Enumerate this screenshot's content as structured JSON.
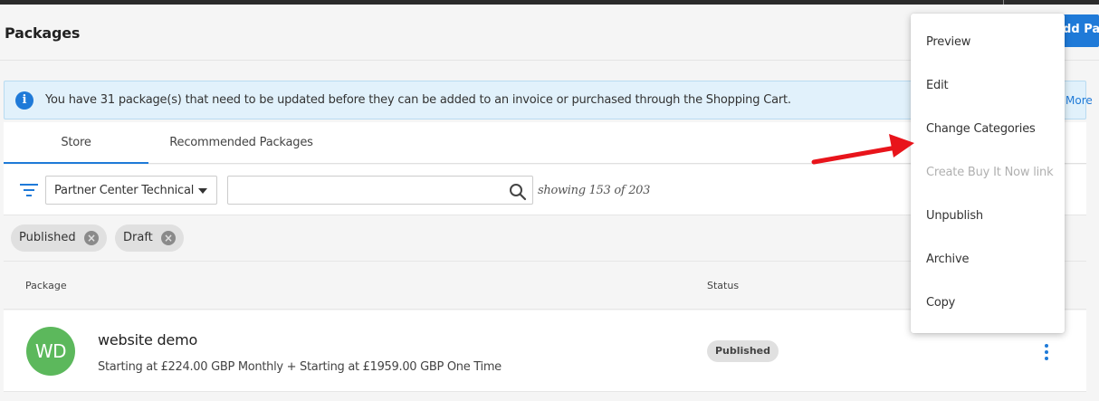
{
  "header": {
    "title": "Packages",
    "add_button_label": "Add Package"
  },
  "banner": {
    "icon": "info-icon",
    "text": "You have 31 package(s) that need to be updated before they can be added to an invoice or purchased through the Shopping Cart.",
    "link": "More"
  },
  "tabs": [
    {
      "label": "Store",
      "active": true
    },
    {
      "label": "Recommended Packages",
      "active": false
    }
  ],
  "filters": {
    "category_select": "Partner Center Technical",
    "search_placeholder": "",
    "showing_text": "showing 153 of 203",
    "chips": [
      "Published",
      "Draft"
    ]
  },
  "table": {
    "headers": {
      "package": "Package",
      "status": "Status"
    },
    "rows": [
      {
        "avatar": "WD",
        "name": "website demo",
        "price": "Starting at £224.00 GBP Monthly + Starting at £1959.00 GBP One Time",
        "status": "Published"
      }
    ]
  },
  "context_menu": {
    "items": [
      {
        "label": "Preview",
        "disabled": false
      },
      {
        "label": "Edit",
        "disabled": false
      },
      {
        "label": "Change Categories",
        "disabled": false
      },
      {
        "label": "Create Buy It Now link",
        "disabled": true
      },
      {
        "label": "Unpublish",
        "disabled": false
      },
      {
        "label": "Archive",
        "disabled": false
      },
      {
        "label": "Copy",
        "disabled": false
      }
    ]
  },
  "colors": {
    "accent": "#1f7ad8",
    "avatar": "#5cb85c",
    "annotation_arrow": "#e8141b",
    "banner_bg": "#e1f1fb"
  }
}
